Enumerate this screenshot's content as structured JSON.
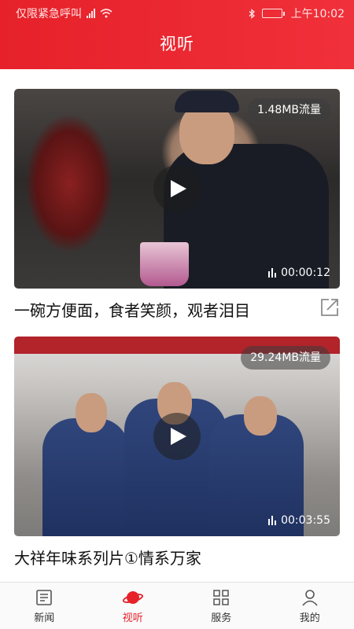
{
  "status_bar": {
    "carrier": "仅限紧急呼叫",
    "battery_label": "",
    "time": "上午10:02"
  },
  "header": {
    "title": "视听"
  },
  "feed": {
    "items": [
      {
        "data_usage": "1.48MB流量",
        "duration": "00:00:12",
        "title": "一碗方便面，食者笑颜，观者泪目",
        "has_share": true
      },
      {
        "data_usage": "29.24MB流量",
        "duration": "00:03:55",
        "title": "大祥年味系列片①情系万家",
        "has_share": false
      }
    ]
  },
  "bottom_nav": {
    "items": [
      {
        "label": "新闻",
        "icon": "news-icon",
        "active": false
      },
      {
        "label": "视听",
        "icon": "planet-icon",
        "active": true
      },
      {
        "label": "服务",
        "icon": "grid-icon",
        "active": false
      },
      {
        "label": "我的",
        "icon": "person-icon",
        "active": false
      }
    ]
  },
  "colors": {
    "accent": "#e6212a",
    "header_bg": "#e6212a",
    "text": "#111111"
  }
}
